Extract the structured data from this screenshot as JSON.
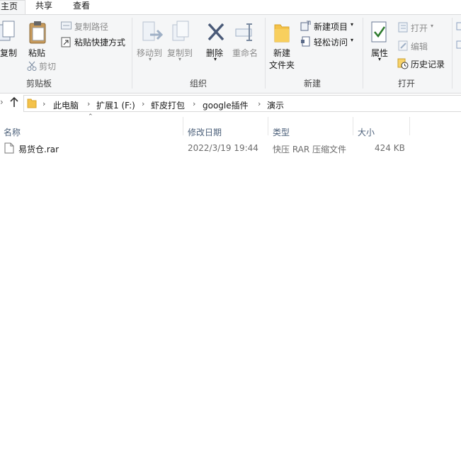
{
  "tabs": {
    "home": "主页",
    "share": "共享",
    "view": "查看"
  },
  "clipboard": {
    "copy": "复制",
    "paste": "粘贴",
    "copy_path": "复制路径",
    "paste_shortcut": "粘贴快捷方式",
    "cut": "剪切",
    "group": "剪贴板"
  },
  "organize": {
    "move_to": "移动到",
    "copy_to": "复制到",
    "delete": "删除",
    "rename": "重命名",
    "group": "组织"
  },
  "new": {
    "new_folder_1": "新建",
    "new_folder_2": "文件夹",
    "new_item": "新建项目",
    "easy_access": "轻松访问",
    "group": "新建"
  },
  "open": {
    "properties": "属性",
    "open": "打开",
    "edit": "编辑",
    "history": "历史记录",
    "group": "打开"
  },
  "breadcrumb": [
    "此电脑",
    "扩展1 (F:)",
    "虾皮打包",
    "google插件",
    "演示"
  ],
  "columns": {
    "name": "名称",
    "modified": "修改日期",
    "type": "类型",
    "size": "大小"
  },
  "files": [
    {
      "name": "易货仓.rar",
      "modified": "2022/3/19 19:44",
      "type": "快压 RAR 压缩文件",
      "size": "424 KB"
    }
  ]
}
